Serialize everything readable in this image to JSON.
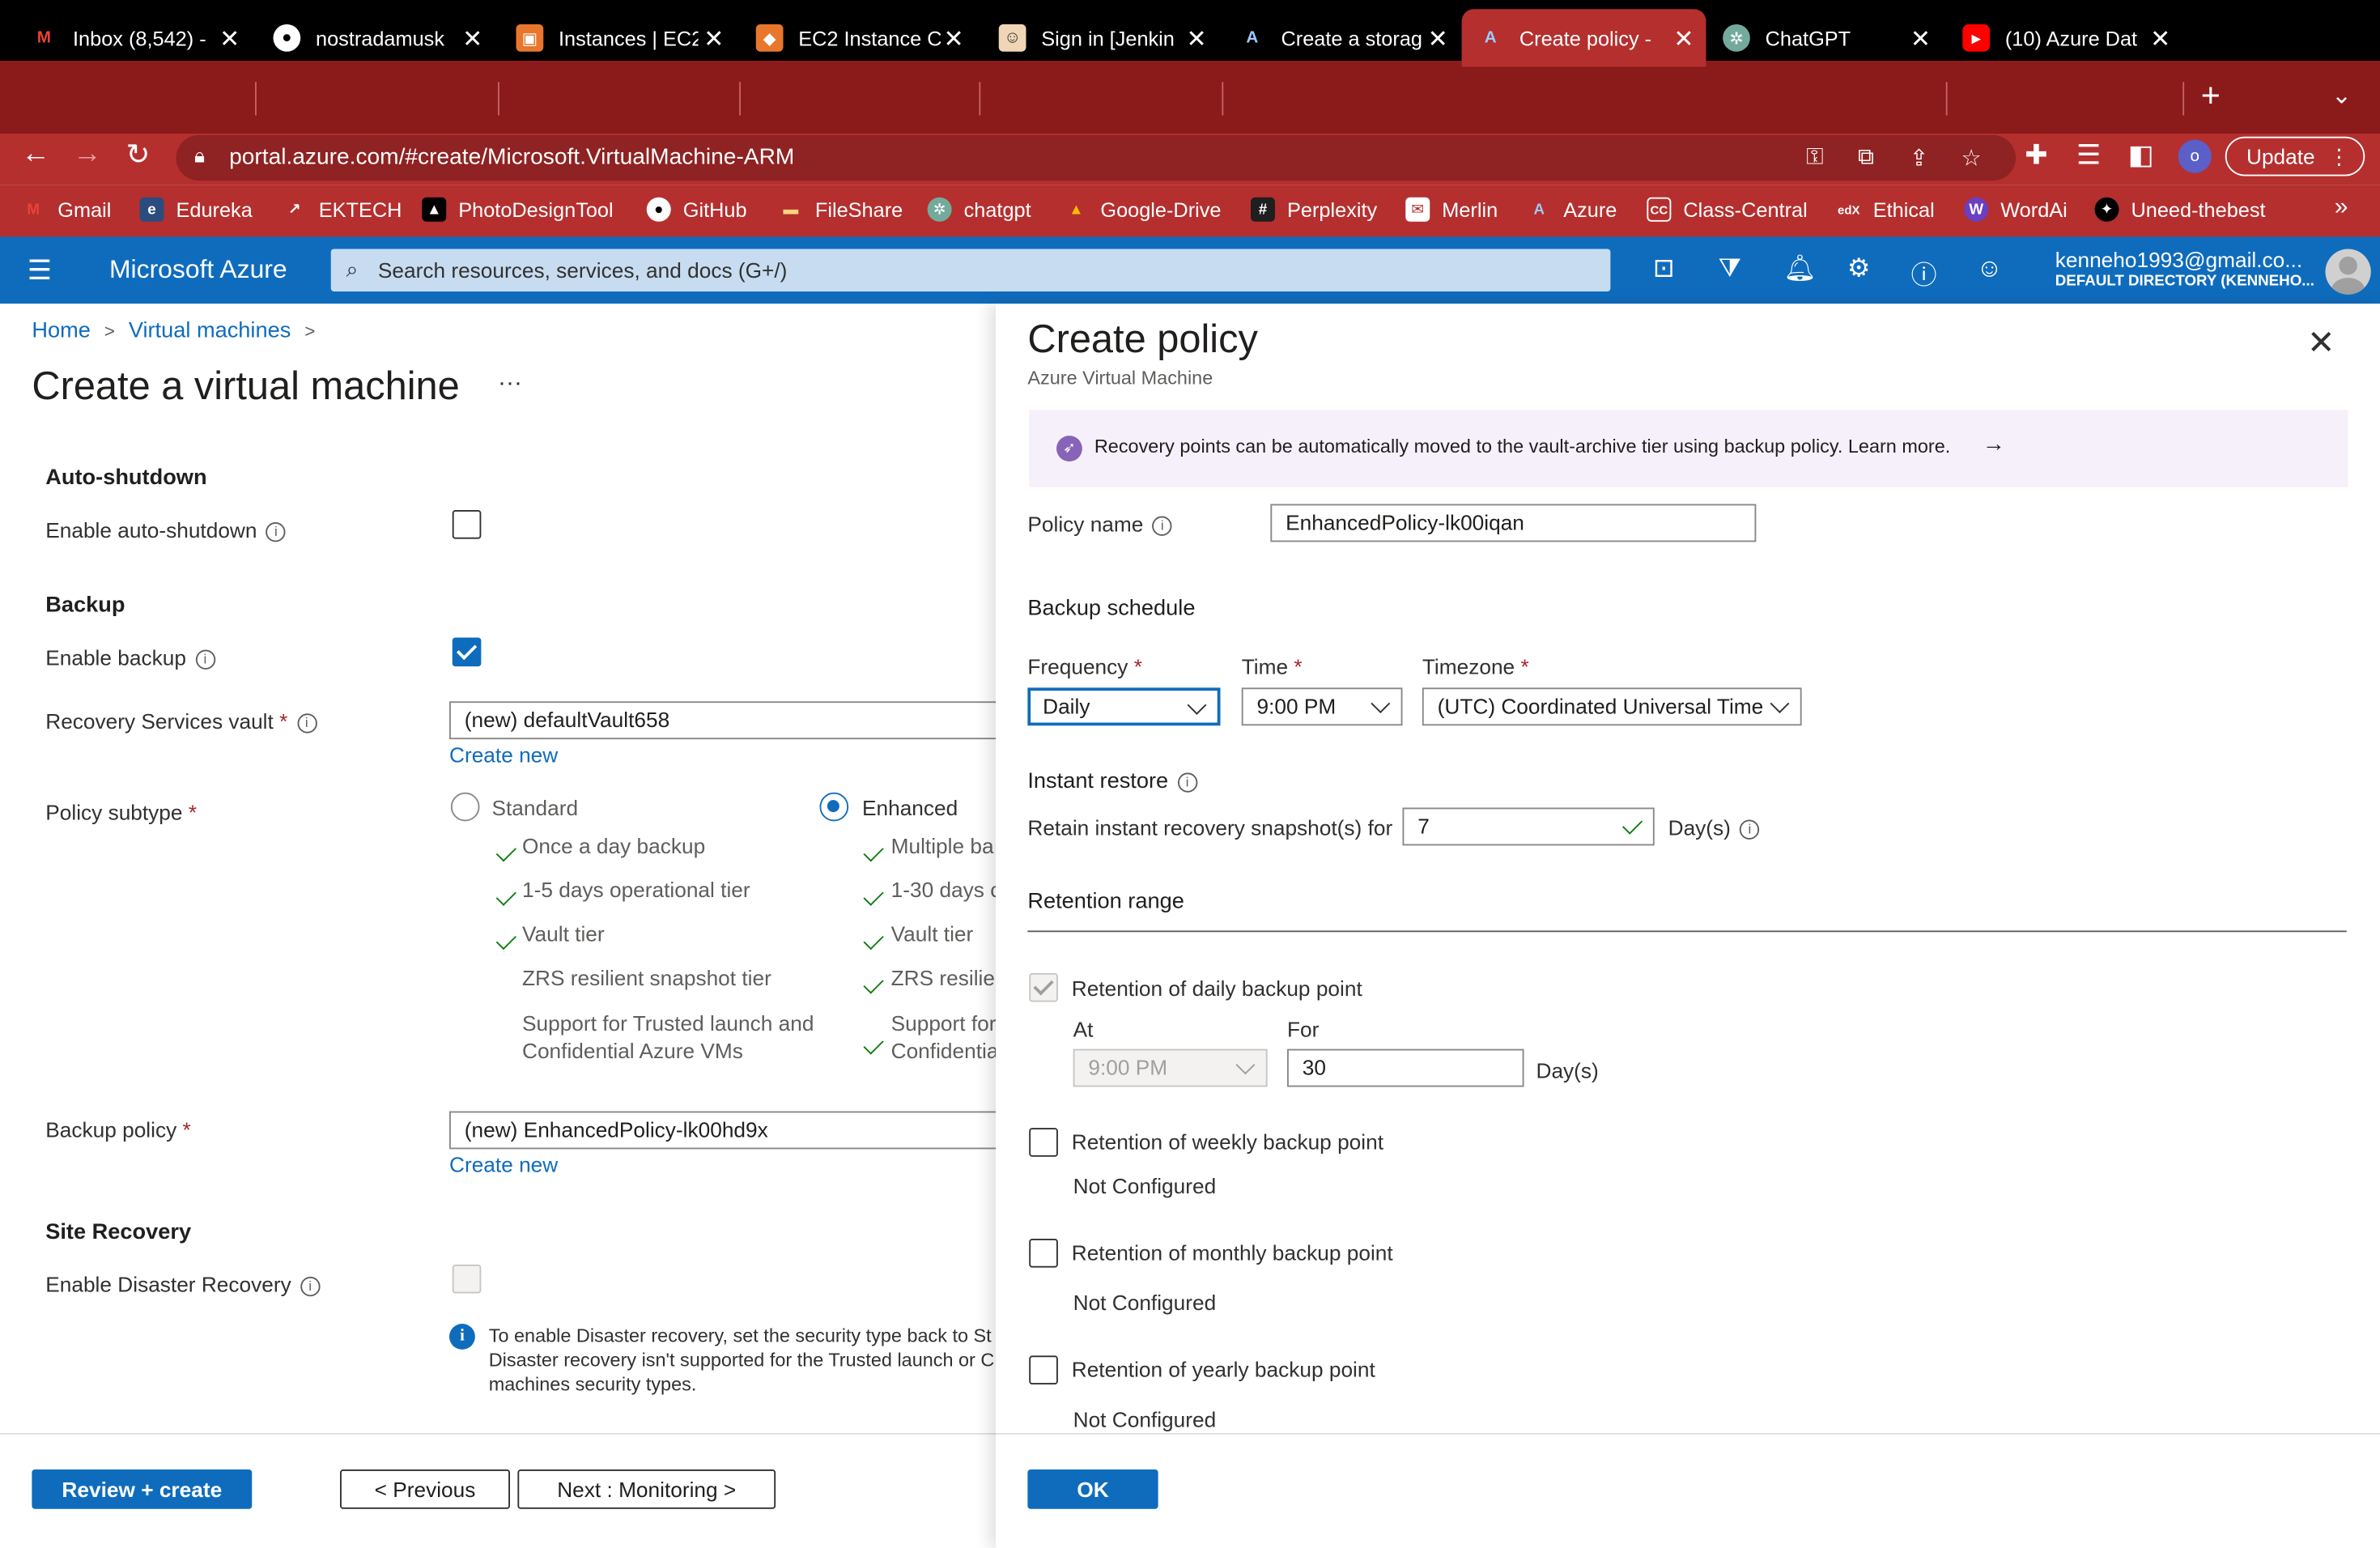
{
  "browser": {
    "tabs": [
      {
        "label": "Inbox (8,542) -",
        "icon": "gmail-icon"
      },
      {
        "label": "nostradamusk",
        "icon": "github-icon"
      },
      {
        "label": "Instances | EC2",
        "icon": "aws-icon"
      },
      {
        "label": "EC2 Instance C",
        "icon": "aws-ec2-icon"
      },
      {
        "label": "Sign in [Jenkin",
        "icon": "jenkins-icon"
      },
      {
        "label": "Create a storag",
        "icon": "azure-icon"
      },
      {
        "label": "Create policy -",
        "icon": "azure-icon",
        "active": true
      },
      {
        "label": "ChatGPT",
        "icon": "chatgpt-icon"
      },
      {
        "label": "(10) Azure Dat",
        "icon": "youtube-icon"
      }
    ],
    "url": "portal.azure.com/#create/Microsoft.VirtualMachine-ARM",
    "profile_initial": "o",
    "update_label": "Update",
    "bookmarks": [
      "Gmail",
      "Edureka",
      "EKTECH",
      "PhotoDesignTool",
      "GitHub",
      "FileShare",
      "chatgpt",
      "Google-Drive",
      "Perplexity",
      "Merlin",
      "Azure",
      "Class-Central",
      "Ethical",
      "WordAi",
      "Uneed-thebest"
    ],
    "bookmarks_more": "»"
  },
  "azure": {
    "brand": "Microsoft Azure",
    "search_placeholder": "Search resources, services, and docs (G+/)",
    "account_email": "kenneho1993@gmail.co...",
    "account_directory": "DEFAULT DIRECTORY (KENNEHO..."
  },
  "page": {
    "breadcrumb": [
      "Home",
      "Virtual machines"
    ],
    "title": "Create a virtual machine",
    "more": "···",
    "auto_shutdown": {
      "heading": "Auto-shutdown",
      "enable_label": "Enable auto-shutdown",
      "enabled": false
    },
    "backup": {
      "heading": "Backup",
      "enable_label": "Enable backup",
      "enabled": true,
      "vault_label": "Recovery Services vault",
      "vault_value": "(new) defaultVault658",
      "create_new": "Create new",
      "policy_subtype_label": "Policy subtype",
      "standard_label": "Standard",
      "enhanced_label": "Enhanced",
      "selected_subtype": "Enhanced",
      "standard_features": [
        "Once a day backup",
        "1-5 days operational tier",
        "Vault tier",
        "ZRS resilient snapshot tier",
        "Support for Trusted launch and",
        "Confidential Azure VMs"
      ],
      "enhanced_features": [
        "Multiple ba",
        "1-30 days c",
        "Vault tier",
        "ZRS resilien",
        "Support for",
        "Confidentia"
      ],
      "backup_policy_label": "Backup policy",
      "backup_policy_value": "(new) EnhancedPolicy-lk00hd9x",
      "create_new_2": "Create new"
    },
    "site_recovery": {
      "heading": "Site Recovery",
      "enable_label": "Enable Disaster Recovery",
      "enabled": false,
      "info_lines": [
        "To enable Disaster recovery, set the security type back to St",
        "Disaster recovery isn't supported for the Trusted launch or C",
        "machines security types."
      ]
    },
    "footer": {
      "review_create": "Review + create",
      "previous": "< Previous",
      "next": "Next : Monitoring >"
    }
  },
  "panel": {
    "title": "Create policy",
    "subtitle": "Azure Virtual Machine",
    "banner": "Recovery points can be automatically moved to the vault-archive tier using backup policy. Learn more.",
    "banner_arrow": "→",
    "policy_name_label": "Policy name",
    "policy_name_value": "EnhancedPolicy-lk00iqan",
    "schedule_heading": "Backup schedule",
    "frequency_label": "Frequency",
    "frequency_value": "Daily",
    "time_label": "Time",
    "time_value": "9:00 PM",
    "timezone_label": "Timezone",
    "timezone_value": "(UTC) Coordinated Universal Time",
    "instant_restore_heading": "Instant restore",
    "retain_label": "Retain instant recovery snapshot(s) for",
    "retain_value": "7",
    "days_label": "Day(s)",
    "retention_heading": "Retention range",
    "daily_label": "Retention of daily backup point",
    "at_label": "At",
    "at_value": "9:00 PM",
    "for_label": "For",
    "for_value": "30",
    "weekly_label": "Retention of weekly backup point",
    "monthly_label": "Retention of monthly backup point",
    "yearly_label": "Retention of yearly backup point",
    "not_configured": "Not Configured",
    "ok_label": "OK",
    "close": "✕"
  },
  "colors": {
    "azure_blue": "#0f6cbd",
    "chrome_tab_bar": "#8b1a1a",
    "chrome_toolbar": "#b52f2f",
    "success_green": "#107c10"
  }
}
